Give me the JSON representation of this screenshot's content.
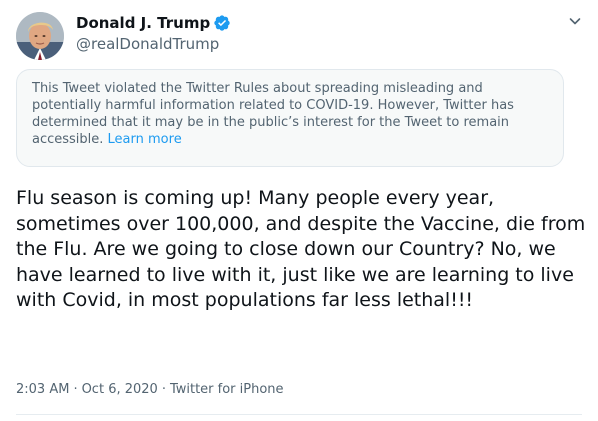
{
  "author": {
    "display_name": "Donald J. Trump",
    "handle": "@realDonaldTrump",
    "verified": true,
    "avatar_icon": "profile-photo"
  },
  "notice": {
    "text": "This Tweet violated the Twitter Rules about spreading misleading and potentially harmful information related to COVID-19. However, Twitter has determined that it may be in the public’s interest for the Tweet to remain accessible.",
    "link_label": "Learn more"
  },
  "tweet": {
    "text": "Flu season is coming up! Many people every year, sometimes over 100,000, and despite the Vaccine, die from the Flu. Are we going to close down our Country? No, we have learned to live with it, just like we are learning to live with Covid, in most populations far less lethal!!!"
  },
  "meta": {
    "time": "2:03 AM",
    "separator": "·",
    "date": "Oct 6, 2020",
    "source": "Twitter for iPhone"
  },
  "colors": {
    "accent": "#1d9bf0",
    "text": "#0f1419",
    "secondary": "#536471",
    "notice_bg": "#f7f9f9"
  }
}
